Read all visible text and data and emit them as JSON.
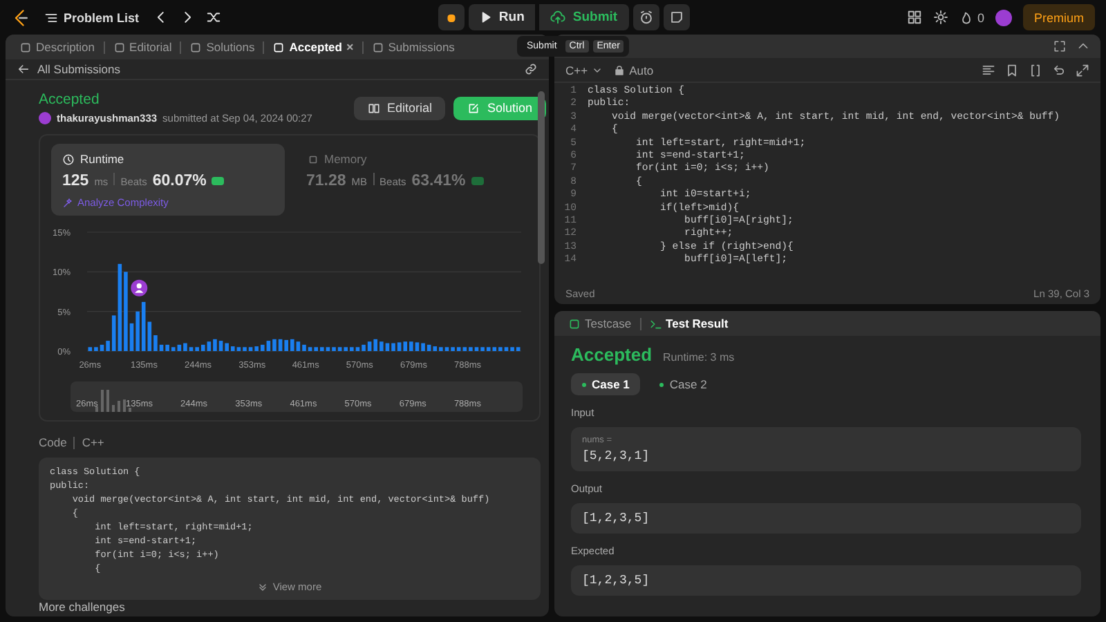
{
  "top_bar": {
    "title": "Problem List",
    "run": "Run",
    "submit": "Submit",
    "streak": "0",
    "premium": "Premium"
  },
  "tooltip": {
    "keys": [
      "Submit",
      "Ctrl",
      "Enter"
    ]
  },
  "left_tabs": [
    {
      "label": "Description",
      "selected": false
    },
    {
      "label": "Editorial",
      "selected": false
    },
    {
      "label": "Solutions",
      "selected": false
    },
    {
      "label": "Accepted",
      "selected": true,
      "close": "×"
    },
    {
      "label": "Submissions",
      "selected": false
    }
  ],
  "submission": {
    "back": "All Submissions",
    "status": "Accepted",
    "user": "thakurayushman333",
    "submitted": "submitted at Sep 04, 2024 00:27",
    "buttons": [
      {
        "label": "Editorial",
        "kind": "secondary"
      },
      {
        "label": "Solution",
        "kind": "primary"
      }
    ]
  },
  "stats": [
    {
      "label": "Runtime",
      "value": "125",
      "unit": "ms",
      "beats_label": "Beats",
      "beats": "60.07%",
      "selected": true,
      "link": "Analyze Complexity"
    },
    {
      "label": "Memory",
      "value": "71.28",
      "unit": "MB",
      "beats_label": "Beats",
      "beats": "63.41%",
      "selected": false
    }
  ],
  "chart_data": {
    "type": "bar",
    "xlim": [
      20,
      896
    ],
    "ylim": [
      0,
      15
    ],
    "x": [
      26,
      38,
      50,
      62,
      74,
      86,
      98,
      110,
      122,
      134,
      146,
      158,
      170,
      182,
      194,
      206,
      218,
      230,
      242,
      254,
      266,
      278,
      290,
      302,
      314,
      326,
      338,
      350,
      362,
      374,
      386,
      398,
      410,
      422,
      434,
      446,
      458,
      470,
      482,
      494,
      506,
      518,
      530,
      542,
      554,
      566,
      578,
      590,
      602,
      614,
      626,
      638,
      650,
      662,
      674,
      686,
      698,
      710,
      722,
      734,
      746,
      758,
      770,
      782,
      794,
      806,
      818,
      830,
      842,
      854,
      866,
      878,
      890
    ],
    "values": [
      0.5,
      0.5,
      0.8,
      1.3,
      4.5,
      11,
      10,
      3.5,
      5,
      6.2,
      3.7,
      2,
      0.8,
      0.8,
      0.5,
      0.8,
      1,
      0.5,
      0.5,
      0.8,
      1.2,
      1.5,
      1.3,
      1,
      0.6,
      0.5,
      0.5,
      0.5,
      0.6,
      0.8,
      1.3,
      1.5,
      1.5,
      1.4,
      1.5,
      1.2,
      0.8,
      0.5,
      0.5,
      0.5,
      0.5,
      0.5,
      0.5,
      0.5,
      0.5,
      0.5,
      0.8,
      1.2,
      1.5,
      1.2,
      1,
      1,
      1.1,
      1.2,
      1.2,
      1.1,
      1,
      0.8,
      0.6,
      0.5,
      0.5,
      0.5,
      0.5,
      0.5,
      0.5,
      0.5,
      0.5,
      0.5,
      0.5,
      0.5,
      0.5,
      0.5,
      0.5
    ],
    "xticks": [
      {
        "value": 26,
        "label": "26ms"
      },
      {
        "value": 135,
        "label": "135ms"
      },
      {
        "value": 244,
        "label": "244ms"
      },
      {
        "value": 353,
        "label": "353ms"
      },
      {
        "value": 461,
        "label": "461ms"
      },
      {
        "value": 570,
        "label": "570ms"
      },
      {
        "value": 679,
        "label": "679ms"
      },
      {
        "value": 788,
        "label": "788ms"
      }
    ],
    "yticks": [
      {
        "value": 0,
        "label": "0%"
      },
      {
        "value": 5,
        "label": "5%"
      },
      {
        "value": 10,
        "label": "10%"
      },
      {
        "value": 15,
        "label": "15%"
      }
    ]
  },
  "range_labels": [
    "26ms",
    "135ms",
    "244ms",
    "353ms",
    "461ms",
    "570ms",
    "679ms",
    "788ms"
  ],
  "code_section": {
    "title": "Code",
    "language": "C++",
    "more": "View more",
    "lines": [
      "class Solution {",
      "public:",
      "    void merge(vector<int>& A, int start, int mid, int end, vector<int>& buff)",
      "    {",
      "        int left=start, right=mid+1;",
      "        int s=end-start+1;",
      "        for(int i=0; i<s; i++)",
      "        {"
    ]
  },
  "more_challenges": "More challenges",
  "editor": {
    "language": "C++",
    "mode": "Auto",
    "status": "Saved",
    "cursor": "Ln 39, Col 3",
    "lines": [
      {
        "n": "1",
        "code": "class Solution {"
      },
      {
        "n": "2",
        "code": "public:"
      },
      {
        "n": "3",
        "code": "    void merge(vector<int>& A, int start, int mid, int end, vector<int>& buff)"
      },
      {
        "n": "4",
        "code": "    {"
      },
      {
        "n": "5",
        "code": "        int left=start, right=mid+1;"
      },
      {
        "n": "6",
        "code": "        int s=end-start+1;"
      },
      {
        "n": "7",
        "code": "        for(int i=0; i<s; i++)"
      },
      {
        "n": "8",
        "code": "        {"
      },
      {
        "n": "9",
        "code": "            int i0=start+i;"
      },
      {
        "n": "10",
        "code": "            if(left>mid){"
      },
      {
        "n": "11",
        "code": "                buff[i0]=A[right];"
      },
      {
        "n": "12",
        "code": "                right++;"
      },
      {
        "n": "13",
        "code": "            } else if (right>end){"
      },
      {
        "n": "14",
        "code": "                buff[i0]=A[left];"
      }
    ]
  },
  "bottom_tabs": [
    {
      "label": "Testcase",
      "selected": false
    },
    {
      "label": "Test Result",
      "selected": true
    }
  ],
  "result": {
    "status": "Accepted",
    "runtime": "Runtime: 3 ms",
    "cases": [
      {
        "label": "Case 1",
        "selected": true
      },
      {
        "label": "Case 2",
        "selected": false
      }
    ],
    "sections": [
      {
        "label": "Input",
        "name": "nums =",
        "value": "[5,2,3,1]"
      },
      {
        "label": "Output",
        "value": "[1,2,3,5]"
      },
      {
        "label": "Expected",
        "value": "[1,2,3,5]"
      }
    ]
  }
}
